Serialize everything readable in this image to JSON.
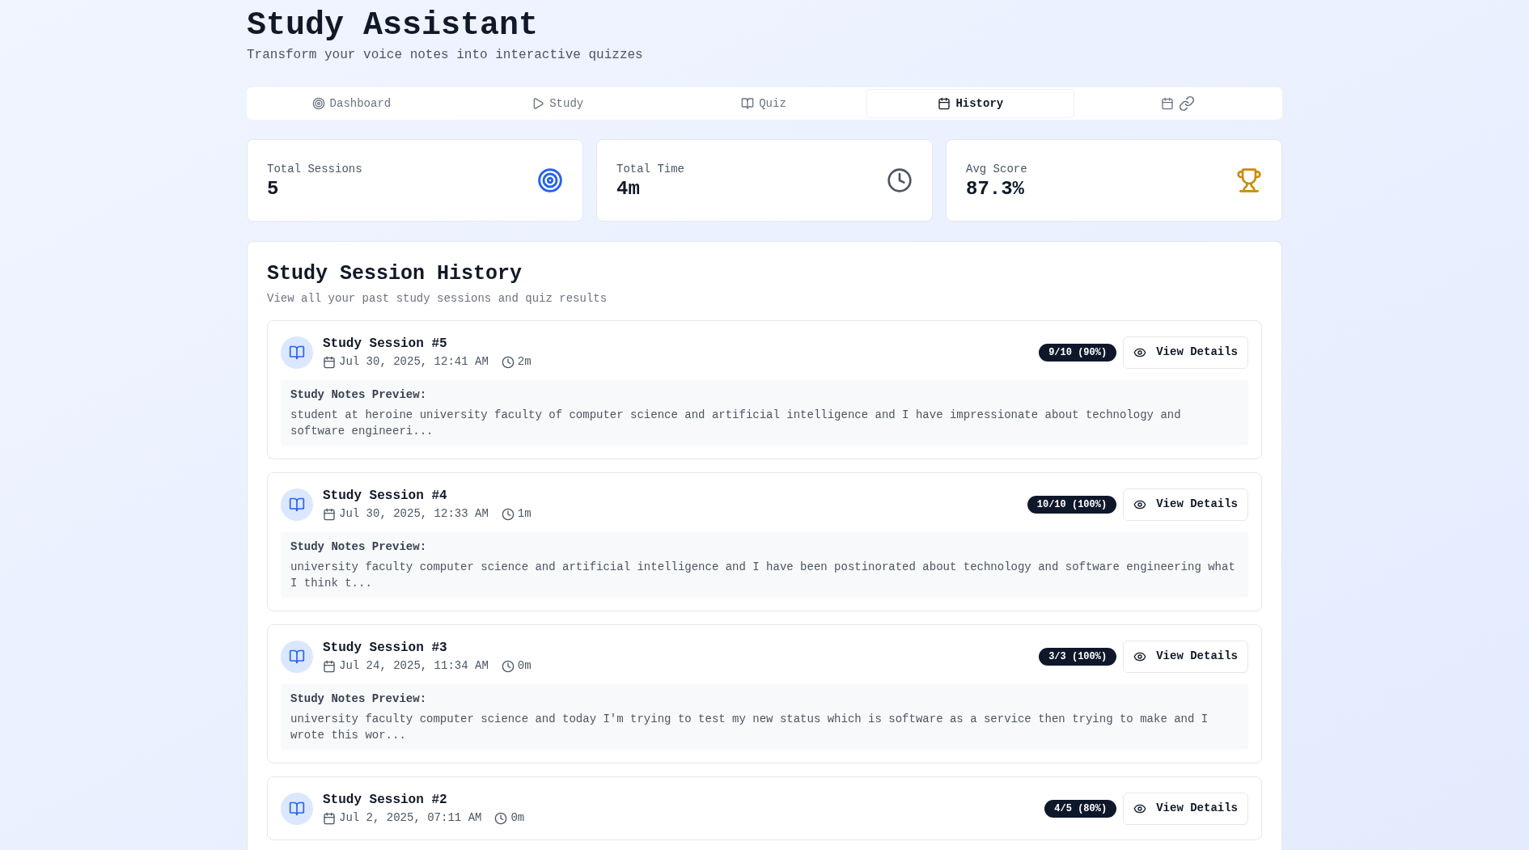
{
  "header": {
    "title": "Study Assistant",
    "subtitle": "Transform your voice notes into interactive quizzes"
  },
  "tabs": [
    {
      "kind": "dashboard",
      "label": "Dashboard",
      "selected": false
    },
    {
      "kind": "study",
      "label": "Study",
      "selected": false
    },
    {
      "kind": "quiz",
      "label": "Quiz",
      "selected": false
    },
    {
      "kind": "history",
      "label": "History",
      "selected": true
    },
    {
      "kind": "calendar-link",
      "selected": false
    }
  ],
  "stats": [
    {
      "kind": "sessions",
      "label": "Total Sessions",
      "value": "5"
    },
    {
      "kind": "time",
      "label": "Total Time",
      "value": "4m"
    },
    {
      "kind": "score",
      "label": "Avg Score",
      "value": "87.3%"
    }
  ],
  "history": {
    "title": "Study Session History",
    "subtitle": "View all your past study sessions and quiz results",
    "sessions": [
      {
        "title": "Study Session #5",
        "date": "Jul 30, 2025, 12:41 AM",
        "duration": "2m",
        "score": "9/10 (90%)",
        "button": "View Details",
        "notes_label": "Study Notes Preview:",
        "notes": "student at heroine university faculty of computer science and artificial intelligence and I have impressionate about technology and software engineeri..."
      },
      {
        "title": "Study Session #4",
        "date": "Jul 30, 2025, 12:33 AM",
        "duration": "1m",
        "score": "10/10 (100%)",
        "button": "View Details",
        "notes_label": "Study Notes Preview:",
        "notes": "university faculty computer science and artificial intelligence and I have been postinorated about technology and software engineering what I think t..."
      },
      {
        "title": "Study Session #3",
        "date": "Jul 24, 2025, 11:34 AM",
        "duration": "0m",
        "score": "3/3 (100%)",
        "button": "View Details",
        "notes_label": "Study Notes Preview:",
        "notes": "university faculty computer science and today I'm trying to test my new status which is software as a service then trying to make and I wrote this wor..."
      },
      {
        "title": "Study Session #2",
        "date": "Jul 2, 2025, 07:11 AM",
        "duration": "0m",
        "score": "4/5 (80%)",
        "button": "View Details"
      }
    ]
  }
}
